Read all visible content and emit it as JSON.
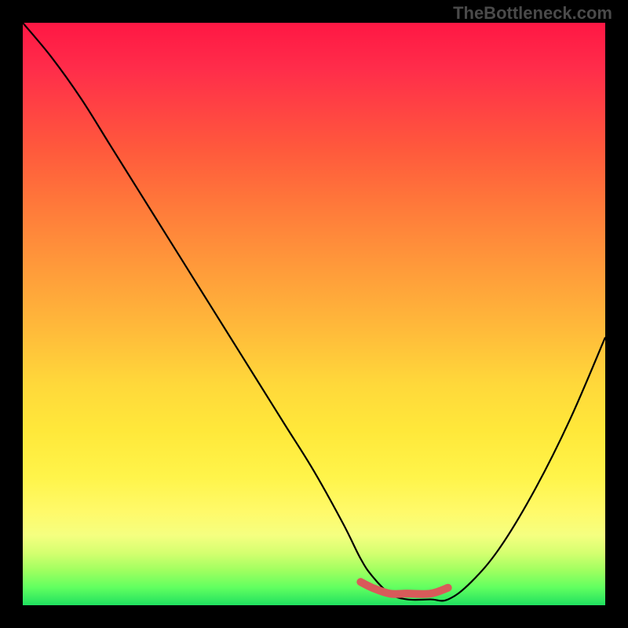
{
  "watermark": "TheBottleneck.com",
  "chart_data": {
    "type": "line",
    "title": "",
    "xlabel": "",
    "ylabel": "",
    "xlim": [
      0,
      100
    ],
    "ylim": [
      0,
      100
    ],
    "series": [
      {
        "name": "bottleneck-curve",
        "color": "#000000",
        "x": [
          0,
          5,
          10,
          15,
          20,
          25,
          30,
          35,
          40,
          45,
          50,
          55,
          58,
          60,
          63,
          66,
          70,
          73,
          77,
          82,
          88,
          94,
          100
        ],
        "y": [
          100,
          94,
          87,
          79,
          71,
          63,
          55,
          47,
          39,
          31,
          23,
          14,
          8,
          5,
          2,
          1,
          1,
          1,
          4,
          10,
          20,
          32,
          46
        ]
      },
      {
        "name": "highlight-segment",
        "color": "#d85a5a",
        "x": [
          58,
          60,
          63,
          66,
          70,
          73
        ],
        "y": [
          4,
          3,
          2,
          2,
          2,
          3
        ]
      }
    ],
    "gradient_note": "vertical rainbow from red (top, high bottleneck) to green (bottom, low bottleneck)"
  }
}
